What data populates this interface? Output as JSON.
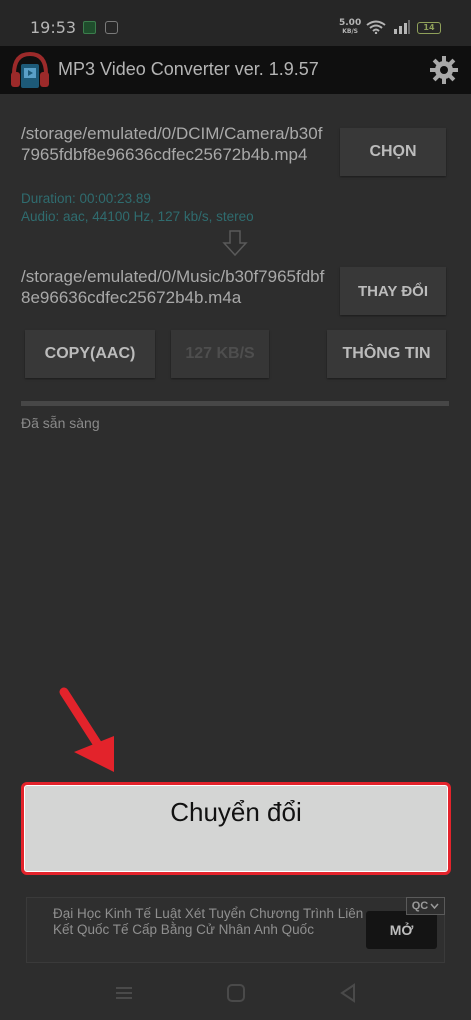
{
  "status_bar": {
    "time": "19:53",
    "net_speed_value": "5.00",
    "net_speed_unit": "KB/S",
    "battery": "14"
  },
  "app_header": {
    "title": "MP3 Video Converter ver. 1.9.57",
    "logo_icon": "headphones-video-icon",
    "settings_icon": "gear-icon"
  },
  "source": {
    "path": "/storage/emulated/0/DCIM/Camera/b30f7965fdbf8e96636cdfec25672b4b.mp4",
    "duration": "Duration: 00:00:23.89",
    "audio": "Audio: aac, 44100 Hz, 127 kb/s, stereo",
    "choose_label": "CHỌN"
  },
  "output": {
    "path": "/storage/emulated/0/Music/b30f7965fdbf8e96636cdfec25672b4b.m4a",
    "change_label": "THAY ĐỔI"
  },
  "options": {
    "format_label": "COPY(AAC)",
    "bitrate_label": "127 KB/S",
    "info_label": "THÔNG TIN"
  },
  "progress": {
    "value": 0,
    "status": "Đã sẵn sàng"
  },
  "convert": {
    "label": "Chuyển đổi"
  },
  "ad": {
    "text": "Đại Học Kinh Tế Luật Xét Tuyển Chương Trình Liên Kết Quốc Tế Cấp Bằng Cử Nhân Anh Quốc",
    "cta": "MỞ",
    "badge": "QC"
  },
  "colors": {
    "accent_red": "#e3232b",
    "meta_teal": "#2f6c6f"
  }
}
